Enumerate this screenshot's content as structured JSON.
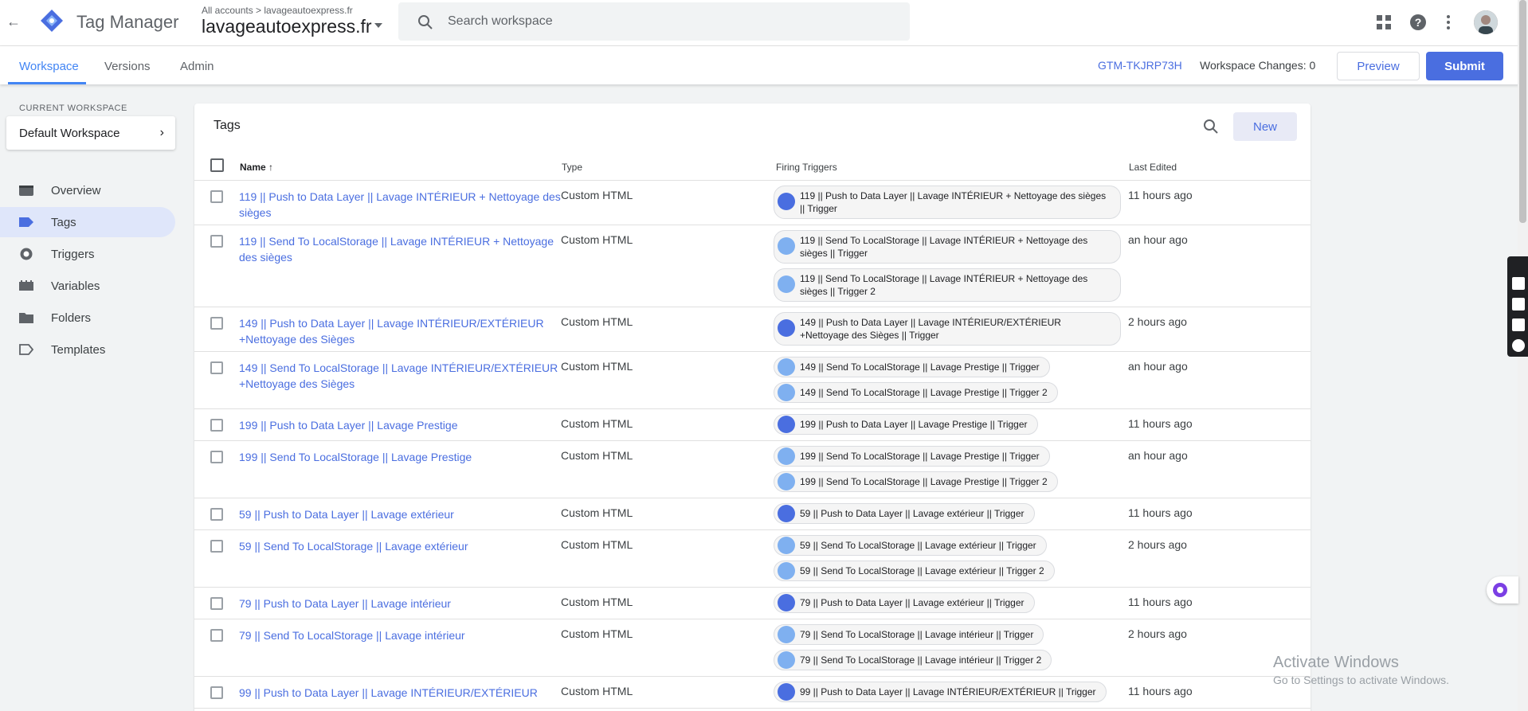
{
  "header": {
    "app_name": "Tag Manager",
    "breadcrumb": "All accounts > lavageautoexpress.fr",
    "container": "lavageautoexpress.fr",
    "search_placeholder": "Search workspace",
    "icons": [
      "apps-grid-icon",
      "help-icon",
      "more-vert-icon"
    ]
  },
  "subnav": {
    "tabs": [
      {
        "label": "Workspace",
        "active": true
      },
      {
        "label": "Versions",
        "active": false
      },
      {
        "label": "Admin",
        "active": false
      }
    ],
    "container_id": "GTM-TKJRP73H",
    "workspace_changes": "Workspace Changes: 0",
    "preview_label": "Preview",
    "submit_label": "Submit"
  },
  "sidebar": {
    "current_workspace_label": "CURRENT WORKSPACE",
    "workspace_name": "Default Workspace",
    "items": [
      {
        "label": "Overview",
        "icon": "overview-icon",
        "active": false
      },
      {
        "label": "Tags",
        "icon": "tag-icon",
        "active": true
      },
      {
        "label": "Triggers",
        "icon": "trigger-icon",
        "active": false
      },
      {
        "label": "Variables",
        "icon": "variables-icon",
        "active": false
      },
      {
        "label": "Folders",
        "icon": "folder-icon",
        "active": false
      },
      {
        "label": "Templates",
        "icon": "template-icon",
        "active": false
      }
    ]
  },
  "tags": {
    "title": "Tags",
    "new_label": "New",
    "columns": {
      "name": "Name",
      "type": "Type",
      "triggers": "Firing Triggers",
      "edited": "Last Edited"
    },
    "rows": [
      {
        "name": "119 || Push to Data Layer || Lavage INTÉRIEUR + Nettoyage des sièges",
        "type": "Custom HTML",
        "edited": "11 hours ago",
        "triggers": [
          {
            "label": "119 || Push to Data Layer || Lavage INTÉRIEUR + Nettoyage des sièges || Trigger",
            "icon": "eye"
          }
        ]
      },
      {
        "name": "119 || Send To LocalStorage || Lavage INTÉRIEUR + Nettoyage des sièges",
        "type": "Custom HTML",
        "edited": "an hour ago",
        "triggers": [
          {
            "label": "119 || Send To LocalStorage || Lavage INTÉRIEUR + Nettoyage des sièges || Trigger",
            "icon": "local"
          },
          {
            "label": "119 || Send To LocalStorage || Lavage INTÉRIEUR + Nettoyage des sièges || Trigger 2",
            "icon": "link"
          }
        ]
      },
      {
        "name": "149 || Push to Data Layer || Lavage INTÉRIEUR/EXTÉRIEUR +Nettoyage des Sièges",
        "type": "Custom HTML",
        "edited": "2 hours ago",
        "triggers": [
          {
            "label": "149 || Push to Data Layer || Lavage INTÉRIEUR/EXTÉRIEUR +Nettoyage des Sièges || Trigger",
            "icon": "eye"
          }
        ]
      },
      {
        "name": "149 || Send To LocalStorage || Lavage INTÉRIEUR/EXTÉRIEUR +Nettoyage des Sièges",
        "type": "Custom HTML",
        "edited": "an hour ago",
        "triggers": [
          {
            "label": "149 || Send To LocalStorage || Lavage Prestige || Trigger",
            "icon": "local"
          },
          {
            "label": "149 || Send To LocalStorage || Lavage Prestige || Trigger 2",
            "icon": "link"
          }
        ]
      },
      {
        "name": "199 || Push to Data Layer || Lavage Prestige",
        "type": "Custom HTML",
        "edited": "11 hours ago",
        "triggers": [
          {
            "label": "199 || Push to Data Layer || Lavage Prestige || Trigger",
            "icon": "eye"
          }
        ]
      },
      {
        "name": "199 || Send To LocalStorage || Lavage Prestige",
        "type": "Custom HTML",
        "edited": "an hour ago",
        "triggers": [
          {
            "label": "199 || Send To LocalStorage || Lavage Prestige || Trigger",
            "icon": "local"
          },
          {
            "label": "199 || Send To LocalStorage || Lavage Prestige || Trigger 2",
            "icon": "link"
          }
        ]
      },
      {
        "name": "59 || Push to Data Layer || Lavage extérieur",
        "type": "Custom HTML",
        "edited": "11 hours ago",
        "triggers": [
          {
            "label": "59 || Push to Data Layer || Lavage extérieur || Trigger",
            "icon": "eye"
          }
        ]
      },
      {
        "name": "59 || Send To LocalStorage || Lavage extérieur",
        "type": "Custom HTML",
        "edited": "2 hours ago",
        "triggers": [
          {
            "label": "59 || Send To LocalStorage || Lavage extérieur || Trigger",
            "icon": "local"
          },
          {
            "label": "59 || Send To LocalStorage || Lavage extérieur || Trigger 2",
            "icon": "link"
          }
        ]
      },
      {
        "name": "79 || Push to Data Layer || Lavage intérieur",
        "type": "Custom HTML",
        "edited": "11 hours ago",
        "triggers": [
          {
            "label": "79 || Push to Data Layer || Lavage extérieur || Trigger",
            "icon": "eye"
          }
        ]
      },
      {
        "name": "79 || Send To LocalStorage || Lavage intérieur",
        "type": "Custom HTML",
        "edited": "2 hours ago",
        "triggers": [
          {
            "label": "79 || Send To LocalStorage || Lavage intérieur || Trigger",
            "icon": "local"
          },
          {
            "label": "79 || Send To LocalStorage || Lavage intérieur || Trigger 2",
            "icon": "link"
          }
        ]
      },
      {
        "name": "99 || Push to Data Layer || Lavage INTÉRIEUR/EXTÉRIEUR",
        "type": "Custom HTML",
        "edited": "11 hours ago",
        "triggers": [
          {
            "label": "99 || Push to Data Layer || Lavage INTÉRIEUR/EXTÉRIEUR || Trigger",
            "icon": "eye"
          }
        ]
      }
    ]
  },
  "watermark": {
    "line1": "Activate Windows",
    "line2": "Go to Settings to activate Windows."
  }
}
